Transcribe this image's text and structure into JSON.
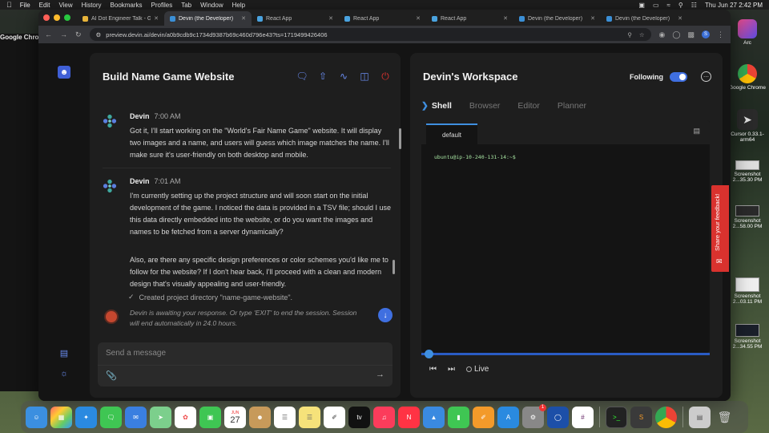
{
  "menubar": {
    "apple": "",
    "app_name": "Google Chrome",
    "items": [
      "File",
      "Edit",
      "View",
      "History",
      "Bookmarks",
      "Profiles",
      "Tab",
      "Window",
      "Help"
    ],
    "clock": "Thu Jun 27  2:42 PM"
  },
  "browser": {
    "tabs": [
      {
        "label": "AI Dot Engineer Talk - Go",
        "color": "#e8b43a"
      },
      {
        "label": "Devin (the Developer)",
        "color": "#3b8fd6",
        "active": true
      },
      {
        "label": "React App",
        "color": "#4aa3df"
      },
      {
        "label": "React App",
        "color": "#4aa3df"
      },
      {
        "label": "React App",
        "color": "#4aa3df"
      },
      {
        "label": "Devin (the Developer)",
        "color": "#3b8fd6"
      },
      {
        "label": "Devin (the Developer)",
        "color": "#3b8fd6"
      }
    ],
    "url": "preview.devin.ai/devin/a0b9cdb9c1734d9387b69c460d796e43?ts=1719499426406",
    "profile_initial": "S"
  },
  "chat": {
    "title": "Build Name Game Website",
    "messages": [
      {
        "author": "Devin",
        "time": "7:00 AM",
        "text": "Got it, I'll start working on the \"World's Fair Name Game\" website. It will display two images and a name, and users will guess which image matches the name. I'll make sure it's user-friendly on both desktop and mobile."
      },
      {
        "author": "Devin",
        "time": "7:01 AM",
        "text": "I'm currently setting up the project structure and will soon start on the initial development of the game. I noticed the data is provided in a TSV file; should I use this data directly embedded into the website, or do you want the images and names to be fetched from a server dynamically?",
        "text2": "Also, are there any specific design preferences or color schemes you'd like me to follow for the website? If I don't hear back, I'll proceed with a clean and modern design that's visually appealing and user-friendly."
      }
    ],
    "created_note": "Created project directory \"name-game-website\".",
    "awaiting": "Devin is awaiting your response. Or type 'EXIT' to end the session. Session will end automatically in 24.0 hours.",
    "composer_placeholder": "Send a message"
  },
  "workspace": {
    "title": "Devin's Workspace",
    "following_label": "Following",
    "following_on": true,
    "tabs": [
      "Shell",
      "Browser",
      "Editor",
      "Planner"
    ],
    "active_tab": "Shell",
    "terminal_tab": "default",
    "prompt": "ubuntu@ip-10-240-131-14:~$",
    "live_label": "Live"
  },
  "feedback": {
    "label": "Share your feedback!"
  },
  "desktop": {
    "icons": [
      {
        "label": "Arc"
      },
      {
        "label": "Google Chrome"
      },
      {
        "label": "Cursor 0.33.1-arm64"
      },
      {
        "label": "Screenshot 2...35.30 PM"
      },
      {
        "label": "Screenshot 2...58.00 PM"
      },
      {
        "label": "Screenshot 2...03.11 PM"
      },
      {
        "label": "Screenshot 2...34.55 PM"
      }
    ]
  },
  "dock": {
    "calendar_day": "27",
    "calendar_month": "JUN",
    "system_settings_badge": "1",
    "tv_label": "tv"
  }
}
